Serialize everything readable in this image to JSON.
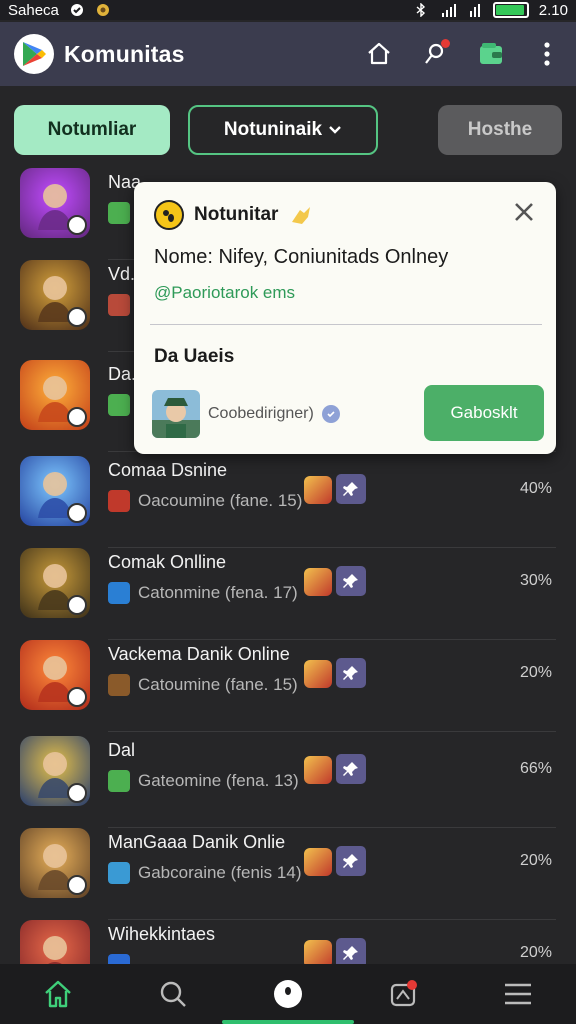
{
  "status": {
    "carrier": "Saheca",
    "time": "2.10",
    "battery_level": 0.95
  },
  "appbar": {
    "title": "Komunitas"
  },
  "filters": [
    {
      "label": "Notumliar",
      "state": "active"
    },
    {
      "label": "Notuninaik",
      "state": "dropdown"
    },
    {
      "label": "Hosthe",
      "state": "disabled"
    }
  ],
  "rows": [
    {
      "name": "Naa...",
      "meta": "",
      "pct": "",
      "thumb": "#6b2b8a",
      "thumb2": "#c14cff",
      "meta_color": "#4caf50"
    },
    {
      "name": "Vd...",
      "meta": "",
      "pct": "",
      "thumb": "#5b3a1c",
      "thumb2": "#d4a13c",
      "meta_color": "#b84a3a"
    },
    {
      "name": "Da...",
      "meta": "",
      "pct": "",
      "thumb": "#c8491c",
      "thumb2": "#ffb03a",
      "meta_color": "#4caf50"
    },
    {
      "name": "Comaa Dsnine",
      "meta": "Oacoumine (fane. 15)",
      "pct": "40%",
      "thumb": "#2d4fa8",
      "thumb2": "#7ec8ff",
      "meta_color": "#c0392b"
    },
    {
      "name": "Comak Onlline",
      "meta": "Catonmine (fena. 17)",
      "pct": "30%",
      "thumb": "#4a3a1c",
      "thumb2": "#c79a3a",
      "meta_color": "#2a7fd4"
    },
    {
      "name": "Vackema Danik Online",
      "meta": "Catoumine (fane. 15)",
      "pct": "20%",
      "thumb": "#b8341e",
      "thumb2": "#ff8a3a",
      "meta_color": "#8a5a2a"
    },
    {
      "name": "Dal",
      "meta": "Gateomine (fena. 13)",
      "pct": "66%",
      "thumb": "#3a4a6a",
      "thumb2": "#e6c14a",
      "meta_color": "#4caf50"
    },
    {
      "name": "ManGaaa Danik Onlie",
      "meta": "Gabcoraine (fenis 14)",
      "pct": "20%",
      "thumb": "#6a4a2a",
      "thumb2": "#e8b05a",
      "meta_color": "#3a9ad4"
    },
    {
      "name": "Wihekkintaes",
      "meta": "",
      "pct": "20%",
      "thumb": "#8a2a2a",
      "thumb2": "#e86a4a",
      "meta_color": "#2a6ad4"
    }
  ],
  "popup": {
    "title": "Notunitar",
    "line1": "Nome: Nifey, Coniunitads Onlney",
    "line2": "@Paoriotarok ems",
    "section": "Da Uaeis",
    "username": "Coobedirigner)",
    "button": "Gabosklt"
  }
}
